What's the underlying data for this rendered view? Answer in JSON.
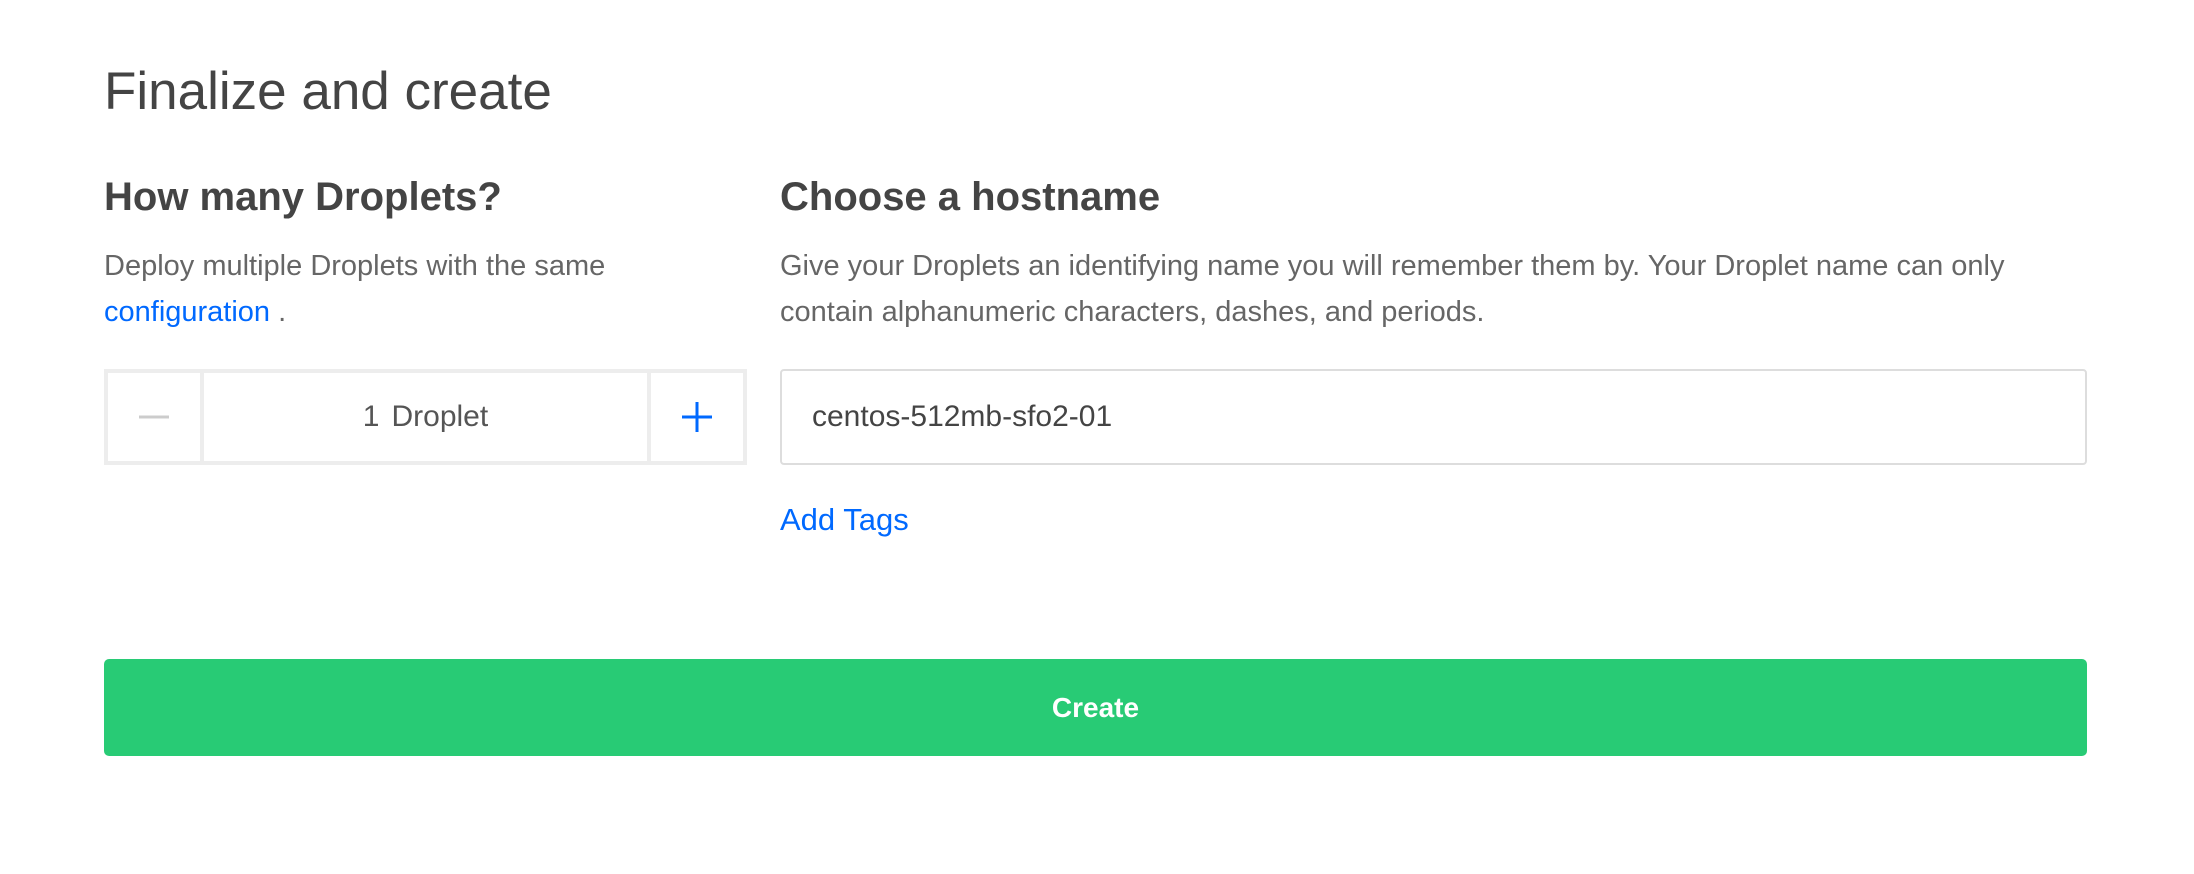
{
  "page": {
    "title": "Finalize and create"
  },
  "droplet_count": {
    "heading": "How many Droplets?",
    "description_prefix": "Deploy multiple Droplets with the same",
    "description_link": "configuration",
    "description_suffix": " .",
    "value": "1",
    "unit": "Droplet",
    "decrement_icon": "minus-icon",
    "increment_icon": "plus-icon"
  },
  "hostname": {
    "heading": "Choose a hostname",
    "description": "Give your Droplets an identifying name you will remember them by. Your Droplet name can only contain alphanumeric characters, dashes, and periods.",
    "value": "centos-512mb-sfo2-01",
    "add_tags_label": "Add Tags"
  },
  "actions": {
    "create_label": "Create"
  },
  "colors": {
    "primary_text": "#444444",
    "muted_text": "#666666",
    "link": "#0069ff",
    "create_button": "#28cb75",
    "border": "#ededed"
  }
}
